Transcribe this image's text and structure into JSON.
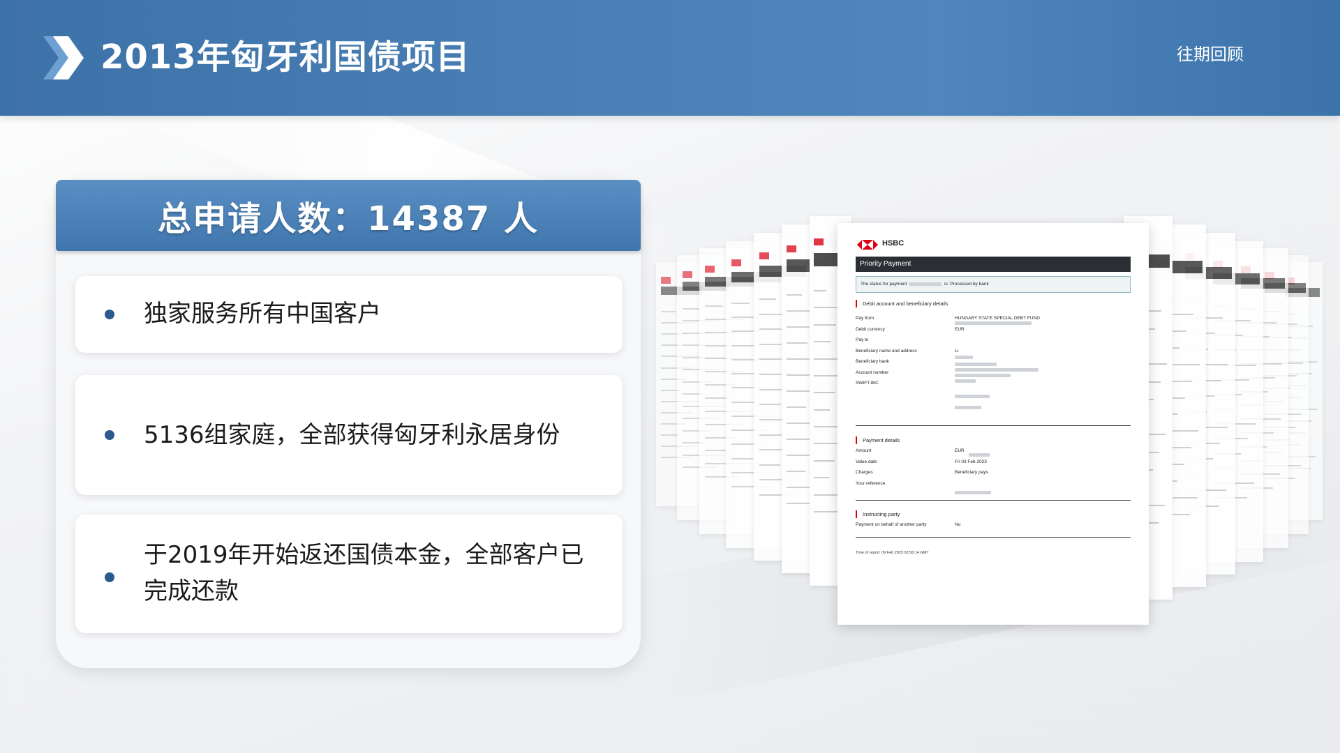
{
  "header": {
    "title": "2013年匈牙利国债项目",
    "link": "往期回顾"
  },
  "stats": {
    "banner": "总申请人数：14387 人",
    "facts": [
      "独家服务所有中国客户",
      "5136组家庭，全部获得匈牙利永居身份",
      "于2019年开始返还国债本金，全部客户已完成还款"
    ]
  },
  "document": {
    "brand": "HSBC",
    "title": "Priority Payment",
    "status_prefix": "The status for payment",
    "status_suffix": "is: Processed by bank",
    "section_debit": "Debit account and beneficiary details",
    "rows_debit": [
      {
        "k": "Pay from",
        "v": "HUNGARY STATE SPECIAL DEBT FUND"
      },
      {
        "k": "Debit currency",
        "v": "EUR"
      },
      {
        "k": "Pay to",
        "v": ""
      },
      {
        "k": "Beneficiary name and address",
        "v": "Li"
      },
      {
        "k": "Beneficiary bank",
        "v": ""
      },
      {
        "k": "Account number",
        "v": ""
      },
      {
        "k": "SWIFT-BIC",
        "v": ""
      }
    ],
    "section_payment": "Payment details",
    "rows_payment": [
      {
        "k": "Amount",
        "v": "EUR"
      },
      {
        "k": "Value date",
        "v": "Fri 03 Feb 2023"
      },
      {
        "k": "Charges",
        "v": "Beneficiary pays"
      },
      {
        "k": "Your reference",
        "v": ""
      }
    ],
    "section_instructing": "Instructing party",
    "rows_instructing": [
      {
        "k": "Payment on behalf of another party",
        "v": "No"
      }
    ],
    "footer": "Time of report: 09 Feb 2023 03:56:14 GMT"
  },
  "colors": {
    "header_blue": "#4a80b6",
    "bullet": "#2c5a8c",
    "hsbc_red": "#db0011"
  }
}
